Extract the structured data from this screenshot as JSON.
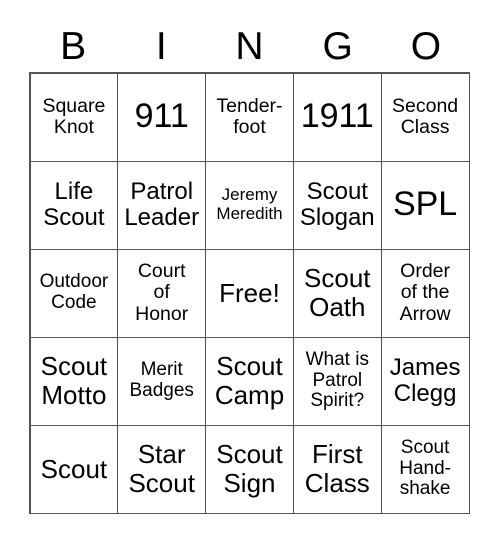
{
  "header": [
    "B",
    "I",
    "N",
    "G",
    "O"
  ],
  "cells": [
    [
      "Square\nKnot",
      "911",
      "Tender-\nfoot",
      "1911",
      "Second\nClass"
    ],
    [
      "Life\nScout",
      "Patrol\nLeader",
      "Jeremy\nMeredith",
      "Scout\nSlogan",
      "SPL"
    ],
    [
      "Outdoor\nCode",
      "Court\nof\nHonor",
      "Free!",
      "Scout\nOath",
      "Order\nof the\nArrow"
    ],
    [
      "Scout\nMotto",
      "Merit\nBadges",
      "Scout\nCamp",
      "What is\nPatrol\nSpirit?",
      "James\nClegg"
    ],
    [
      "Scout",
      "Star\nScout",
      "Scout\nSign",
      "First\nClass",
      "Scout\nHand-\nshake"
    ]
  ],
  "free_space": "Free!"
}
